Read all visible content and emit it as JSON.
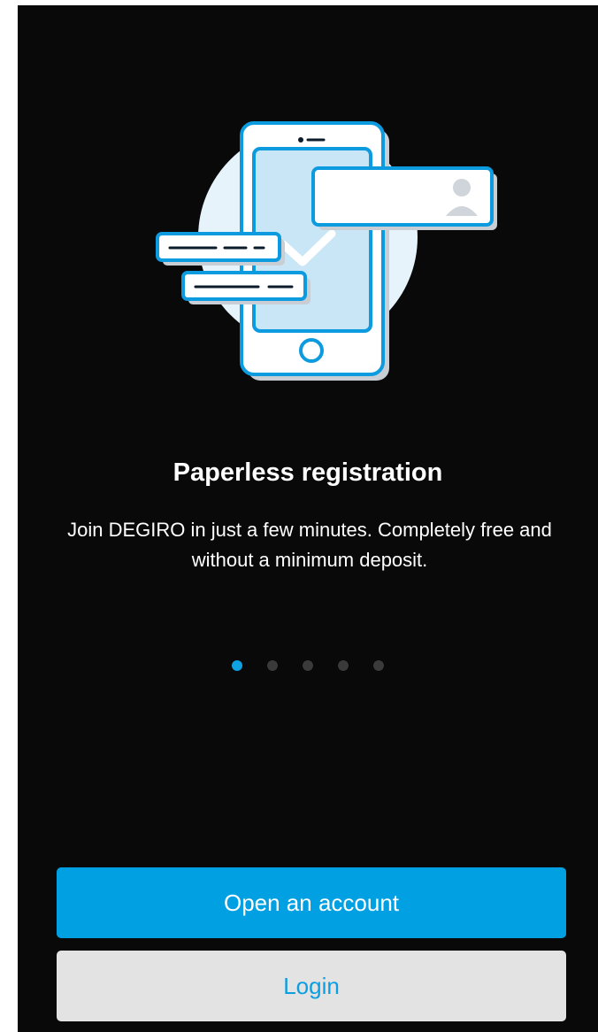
{
  "onboarding": {
    "title": "Paperless registration",
    "description": "Join DEGIRO in just a few minutes. Completely free and without a minimum deposit.",
    "illustration": "phone-registration-illustration",
    "pagination": {
      "total": 5,
      "current": 1
    }
  },
  "actions": {
    "open_account_label": "Open an account",
    "login_label": "Login"
  },
  "colors": {
    "background": "#090909",
    "accent": "#00a0e3",
    "secondary_button": "#e3e3e3",
    "inactive_dot": "#3a3a3a"
  }
}
